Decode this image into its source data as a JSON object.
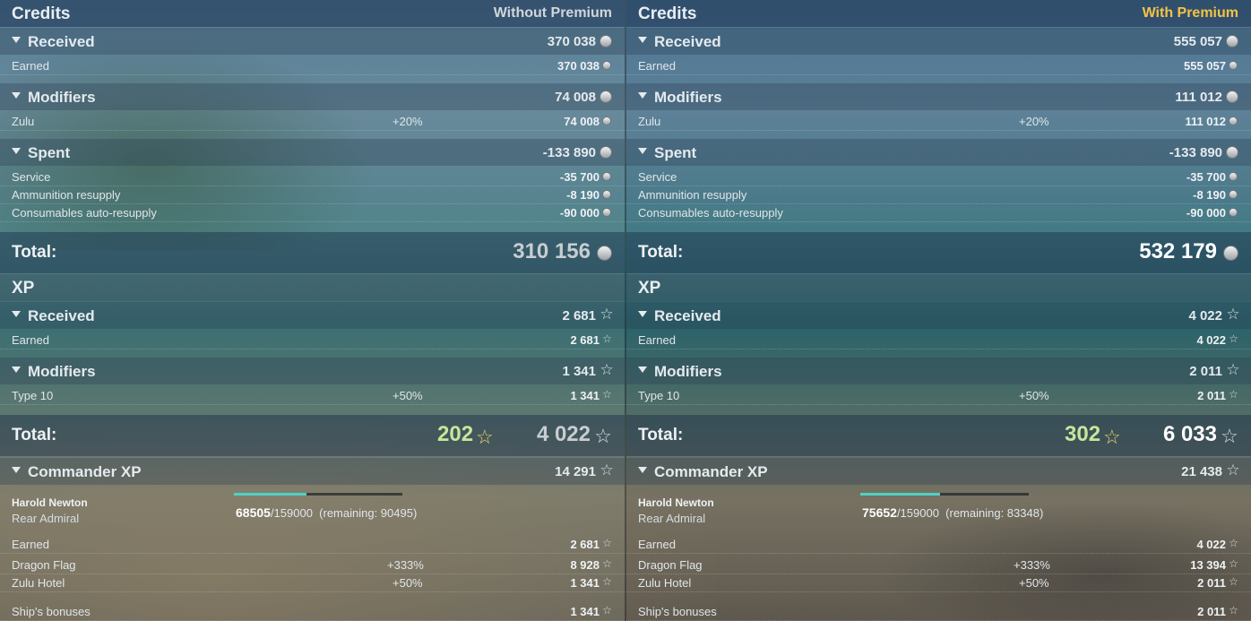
{
  "colors": {
    "without_premium": "#d1d6da",
    "with_premium": "#f2c443",
    "total_grey": "#c7cdd0",
    "total_white": "#ffffff",
    "bonus_green": "#c6e69a",
    "bar_fill": "#4fd1c4"
  },
  "left": {
    "credits": {
      "title": "Credits",
      "label": "Without Premium",
      "received": {
        "label": "Received",
        "value": "370 038",
        "items": [
          {
            "label": "Earned",
            "value": "370 038"
          }
        ]
      },
      "modifiers": {
        "label": "Modifiers",
        "value": "74 008",
        "items": [
          {
            "label": "Zulu",
            "pct": "+20%",
            "value": "74 008"
          }
        ]
      },
      "spent": {
        "label": "Spent",
        "value": "-133 890",
        "items": [
          {
            "label": "Service",
            "value": "-35 700"
          },
          {
            "label": "Ammunition resupply",
            "value": "-8 190"
          },
          {
            "label": "Consumables auto-resupply",
            "value": "-90 000"
          }
        ]
      },
      "total": {
        "label": "Total:",
        "value": "310 156"
      }
    },
    "xp": {
      "title": "XP",
      "received": {
        "label": "Received",
        "value": "2 681",
        "items": [
          {
            "label": "Earned",
            "value": "2 681"
          }
        ]
      },
      "modifiers": {
        "label": "Modifiers",
        "value": "1 341",
        "items": [
          {
            "label": "Type 10",
            "pct": "+50%",
            "value": "1 341"
          }
        ]
      },
      "total": {
        "label": "Total:",
        "bonus": "202",
        "value": "4 022"
      }
    },
    "commander": {
      "label": "Commander XP",
      "value": "14 291",
      "name": "Harold Newton",
      "rank": "Rear Admiral",
      "current": "68505",
      "max": "/159000",
      "remaining": "(remaining: 90495)",
      "progress": 0.43,
      "items": [
        {
          "label": "Earned",
          "value": "2 681"
        },
        {
          "label": "Dragon Flag",
          "pct": "+333%",
          "value": "8 928"
        },
        {
          "label": "Zulu Hotel",
          "pct": "+50%",
          "value": "1 341"
        },
        {
          "label": "Ship's bonuses",
          "value": "1 341"
        }
      ]
    }
  },
  "right": {
    "credits": {
      "title": "Credits",
      "label": "With Premium",
      "received": {
        "label": "Received",
        "value": "555 057",
        "items": [
          {
            "label": "Earned",
            "value": "555 057"
          }
        ]
      },
      "modifiers": {
        "label": "Modifiers",
        "value": "111 012",
        "items": [
          {
            "label": "Zulu",
            "pct": "+20%",
            "value": "111 012"
          }
        ]
      },
      "spent": {
        "label": "Spent",
        "value": "-133 890",
        "items": [
          {
            "label": "Service",
            "value": "-35 700"
          },
          {
            "label": "Ammunition resupply",
            "value": "-8 190"
          },
          {
            "label": "Consumables auto-resupply",
            "value": "-90 000"
          }
        ]
      },
      "total": {
        "label": "Total:",
        "value": "532 179"
      }
    },
    "xp": {
      "title": "XP",
      "received": {
        "label": "Received",
        "value": "4 022",
        "items": [
          {
            "label": "Earned",
            "value": "4 022"
          }
        ]
      },
      "modifiers": {
        "label": "Modifiers",
        "value": "2 011",
        "items": [
          {
            "label": "Type 10",
            "pct": "+50%",
            "value": "2 011"
          }
        ]
      },
      "total": {
        "label": "Total:",
        "bonus": "302",
        "value": "6 033"
      }
    },
    "commander": {
      "label": "Commander XP",
      "value": "21 438",
      "name": "Harold Newton",
      "rank": "Rear Admiral",
      "current": "75652",
      "max": "/159000",
      "remaining": "(remaining: 83348)",
      "progress": 0.475,
      "items": [
        {
          "label": "Earned",
          "value": "4 022"
        },
        {
          "label": "Dragon Flag",
          "pct": "+333%",
          "value": "13 394"
        },
        {
          "label": "Zulu Hotel",
          "pct": "+50%",
          "value": "2 011"
        },
        {
          "label": "Ship's bonuses",
          "value": "2 011"
        }
      ]
    }
  }
}
